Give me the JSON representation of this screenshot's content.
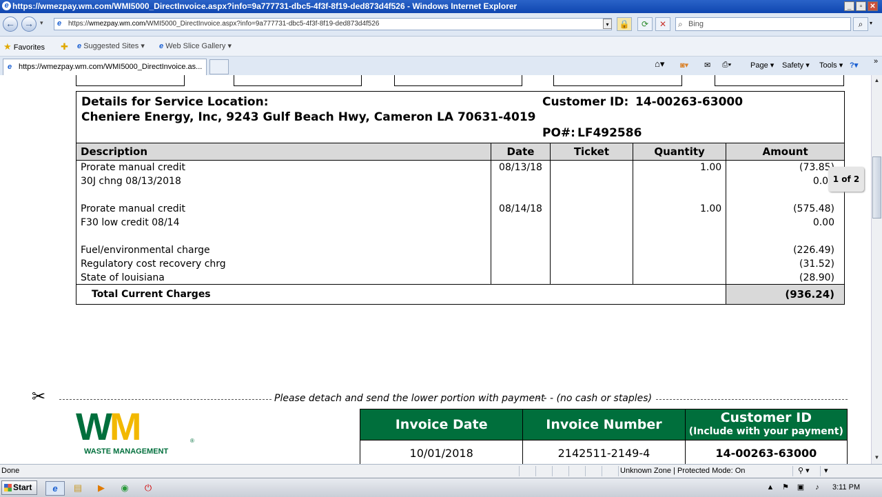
{
  "window": {
    "title": "https://wmezpay.wm.com/WMI5000_DirectInvoice.aspx?info=9a777731-dbc5-4f3f-8f19-ded873d4f526 - Windows Internet Explorer"
  },
  "address_bar": {
    "prefix": "https://",
    "host": "wmezpay.wm.com",
    "path": "/WMI5000_DirectInvoice.aspx?info=9a777731-dbc5-4f3f-8f19-ded873d4f526"
  },
  "search": {
    "placeholder": "Bing"
  },
  "favorites_bar": {
    "favorites_label": "Favorites",
    "suggested_sites": "Suggested Sites",
    "web_slice_gallery": "Web Slice Gallery"
  },
  "tab": {
    "title": "https://wmezpay.wm.com/WMI5000_DirectInvoice.as..."
  },
  "command_bar": {
    "page": "Page",
    "safety": "Safety",
    "tools": "Tools"
  },
  "invoice": {
    "service_location_label": "Details for Service Location:",
    "service_location": "Cheniere Energy, Inc, 9243 Gulf Beach Hwy, Cameron LA 70631-4019",
    "customer_id_label": "Customer ID:",
    "customer_id": "14-00263-63000",
    "po_label": "PO#:",
    "po_number": "LF492586",
    "columns": [
      "Description",
      "Date",
      "Ticket",
      "Quantity",
      "Amount"
    ],
    "rows": [
      {
        "description": [
          "Prorate manual credit",
          "30J chng 08/13/2018"
        ],
        "date": "08/13/18",
        "ticket": "",
        "quantity": "1.00",
        "amount": [
          "(73.85)",
          "0.00"
        ]
      },
      {
        "description": [
          "Prorate manual credit",
          "F30 low credit 08/14"
        ],
        "date": "08/14/18",
        "ticket": "",
        "quantity": "1.00",
        "amount": [
          "(575.48)",
          "0.00"
        ]
      },
      {
        "description": [
          "Fuel/environmental charge",
          "Regulatory cost recovery chrg",
          "State of louisiana"
        ],
        "date": "",
        "ticket": "",
        "quantity": "",
        "amount": [
          "(226.49)",
          "(31.52)",
          "(28.90)"
        ]
      }
    ],
    "total_label": "Total Current Charges",
    "total_amount": "(936.24)",
    "page_indicator": "1 of 2",
    "detach_text": "Please detach and send the lower portion with payment",
    "detach_note": "- - - (no cash or staples)",
    "logo_letters": "WM",
    "logo_text": "WASTE MANAGEMENT",
    "stub_headers": [
      "Invoice Date",
      "Invoice Number",
      "Customer ID"
    ],
    "stub_subheader": "(Include with your payment)",
    "stub_values": [
      "10/01/2018",
      "2142511-2149-4",
      "14-00263-63000"
    ]
  },
  "status_bar": {
    "left": "Done",
    "zone": "Unknown Zone | Protected Mode: On"
  },
  "taskbar": {
    "start_label": "Start",
    "clock": "3:11 PM"
  },
  "colors": {
    "wm_green": "#006f3c",
    "wm_yellow": "#f2b800",
    "header_gray": "#d9d9d9"
  },
  "icons": [
    "ie-logo-icon",
    "back-icon",
    "forward-icon",
    "lock-icon",
    "refresh-icon",
    "stop-icon",
    "search-icon",
    "favorites-star-icon",
    "home-icon",
    "rss-icon",
    "mail-icon",
    "print-icon",
    "help-icon",
    "scissors-icon",
    "start-flag-icon"
  ]
}
